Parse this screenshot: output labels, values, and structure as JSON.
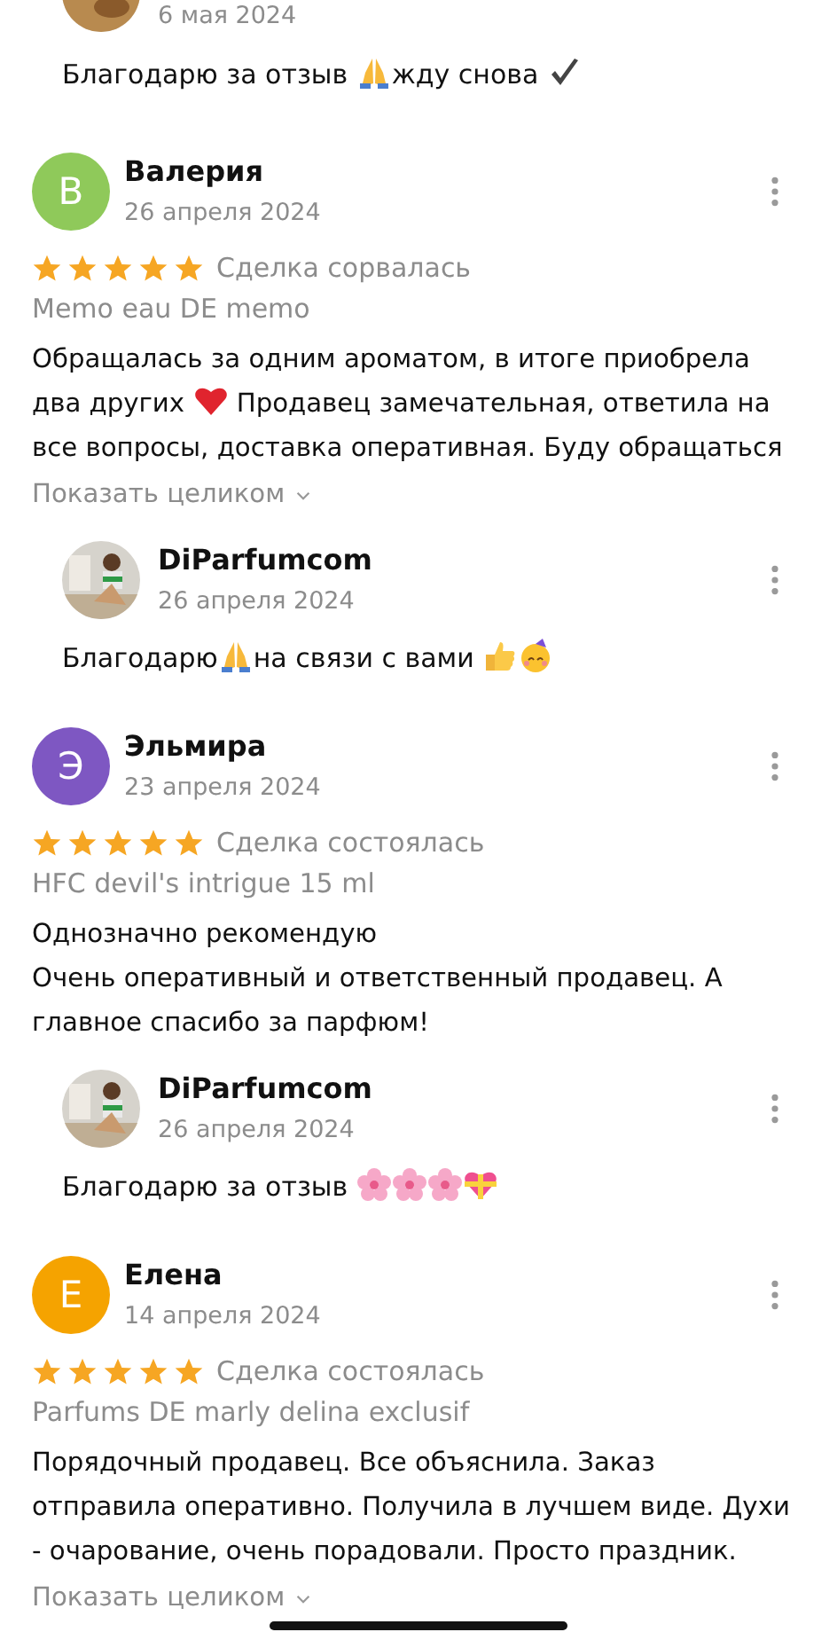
{
  "top_reply": {
    "date": "6 мая 2024",
    "text": [
      {
        "kind": "text",
        "text": "Благодарю за отзыв "
      },
      {
        "kind": "pray"
      },
      {
        "kind": "text",
        "text": "жду снова "
      },
      {
        "kind": "check"
      }
    ]
  },
  "reviews": [
    {
      "initial": "В",
      "color": "#8fc95a",
      "name": "Валерия",
      "date": "26 апреля 2024",
      "stars": 5,
      "status": "Сделка сорвалась",
      "product": "Memo eau DE memo",
      "body": [
        {
          "kind": "text",
          "text": "Обращалась за одним ароматом, в итоге приобрела два других "
        },
        {
          "kind": "heart"
        },
        {
          "kind": "text",
          "text": " Продавец замечательная, ответила на все вопросы, доставка оперативная. Буду обращаться"
        }
      ],
      "show_full": "Показать целиком",
      "reply": {
        "name": "DiParfumcom",
        "date": "26 апреля 2024",
        "text": [
          {
            "kind": "text",
            "text": "Благодарю"
          },
          {
            "kind": "pray"
          },
          {
            "kind": "text",
            "text": "на связи с вами "
          },
          {
            "kind": "thumbs"
          },
          {
            "kind": "party"
          }
        ]
      }
    },
    {
      "initial": "Э",
      "color": "#7e57c2",
      "name": "Эльмира",
      "date": "23 апреля 2024",
      "stars": 5,
      "status": "Сделка состоялась",
      "product": "HFC devil's intrigue 15 ml",
      "body": [
        {
          "kind": "text",
          "text": "Однозначно рекомендую\nОчень оперативный и ответственный продавец. А главное спасибо за парфюм!"
        }
      ],
      "reply": {
        "name": "DiParfumcom",
        "date": "26 апреля 2024",
        "text": [
          {
            "kind": "text",
            "text": "Благодарю за отзыв "
          },
          {
            "kind": "blossom"
          },
          {
            "kind": "blossom"
          },
          {
            "kind": "blossom"
          },
          {
            "kind": "gift-heart"
          }
        ]
      }
    },
    {
      "initial": "Е",
      "color": "#f5a300",
      "name": "Елена",
      "date": "14 апреля 2024",
      "stars": 5,
      "status": "Сделка состоялась",
      "product": "Parfums DE marly delina exclusif",
      "body": [
        {
          "kind": "text",
          "text": "Порядочный продавец. Все объяснила. Заказ отправила оперативно. Получила в лучшем виде. Духи - очарование, очень порадовали. Просто праздник."
        }
      ],
      "show_full": "Показать целиком"
    }
  ]
}
